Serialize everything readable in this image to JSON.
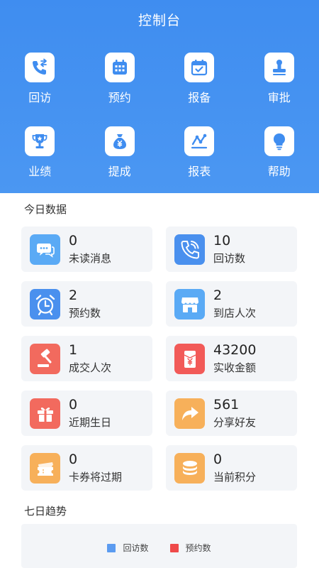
{
  "header": {
    "title": "控制台"
  },
  "menu": [
    {
      "label": "回访",
      "icon": "phone-callback-icon"
    },
    {
      "label": "预约",
      "icon": "calendar-icon"
    },
    {
      "label": "报备",
      "icon": "calendar-check-icon"
    },
    {
      "label": "审批",
      "icon": "stamp-icon"
    },
    {
      "label": "业绩",
      "icon": "trophy-icon"
    },
    {
      "label": "提成",
      "icon": "money-bag-icon"
    },
    {
      "label": "报表",
      "icon": "line-chart-icon"
    },
    {
      "label": "帮助",
      "icon": "lightbulb-icon"
    }
  ],
  "today": {
    "title": "今日数据",
    "cards": [
      {
        "value": "0",
        "label": "未读消息",
        "icon": "chat-bubble-icon",
        "color": "#5aaaf5"
      },
      {
        "value": "10",
        "label": "回访数",
        "icon": "phone-icon",
        "color": "#4a90ee"
      },
      {
        "value": "2",
        "label": "预约数",
        "icon": "alarm-clock-icon",
        "color": "#4a90ee"
      },
      {
        "value": "2",
        "label": "到店人次",
        "icon": "store-icon",
        "color": "#5aaaf5"
      },
      {
        "value": "1",
        "label": "成交人次",
        "icon": "gavel-icon",
        "color": "#f26a5e"
      },
      {
        "value": "43200",
        "label": "实收金额",
        "icon": "yen-envelope-icon",
        "color": "#f25a58"
      },
      {
        "value": "0",
        "label": "近期生日",
        "icon": "gift-icon",
        "color": "#f26a5e"
      },
      {
        "value": "561",
        "label": "分享好友",
        "icon": "share-arrow-icon",
        "color": "#f7b05a"
      },
      {
        "value": "0",
        "label": "卡券将过期",
        "icon": "coupon-icon",
        "color": "#f7b05a"
      },
      {
        "value": "0",
        "label": "当前积分",
        "icon": "coin-stack-icon",
        "color": "#f7b05a"
      }
    ]
  },
  "trend": {
    "title": "七日趋势",
    "legend": [
      {
        "label": "回访数",
        "color": "#5b9bf0"
      },
      {
        "label": "预约数",
        "color": "#ef4a4a"
      }
    ]
  }
}
